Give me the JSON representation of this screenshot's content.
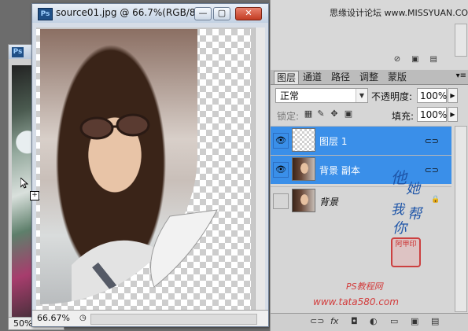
{
  "bg_window": {
    "zoom": "50%"
  },
  "doc_window": {
    "title": "source01.jpg @ 66.7%(RGB/8...",
    "zoom": "66.67%",
    "buttons": {
      "minimize": "—",
      "maximize": "▢",
      "close": "✕"
    }
  },
  "top_panel": {
    "brand": "思缘设计论坛  www.MISSYUAN.COM"
  },
  "layers_panel": {
    "tabs": [
      "图层",
      "通道",
      "路径",
      "调整",
      "蒙版"
    ],
    "blend_mode": "正常",
    "opacity_label": "不透明度:",
    "opacity": "100%",
    "lock_label": "锁定:",
    "fill_label": "填充:",
    "fill": "100%",
    "layers": [
      {
        "name": "图层 1",
        "visible": true,
        "selected": true,
        "thumb": "transparent"
      },
      {
        "name": "背景 副本",
        "visible": true,
        "selected": true,
        "thumb": "photo"
      },
      {
        "name": "背景",
        "visible": false,
        "selected": false,
        "thumb": "photo",
        "locked": true
      }
    ]
  },
  "watermarks": {
    "sig_chars": [
      "他",
      "她",
      "我",
      "帮",
      "你"
    ],
    "seal_text": "阿甲印",
    "ps_site": "PS教程网",
    "url": "www.tata580.com"
  },
  "icons": {
    "eye": "eye-icon",
    "link": "link-icon",
    "lock": "lock-icon"
  }
}
